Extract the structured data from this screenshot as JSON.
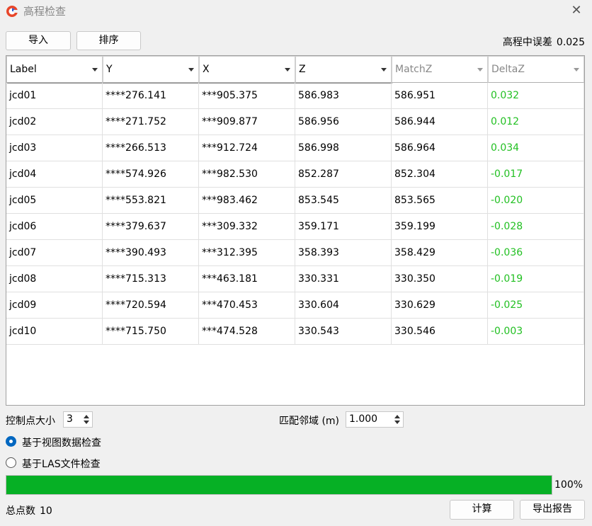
{
  "window": {
    "title": "高程检查",
    "close_icon": "close-icon"
  },
  "toolbar": {
    "import_label": "导入",
    "sort_label": "排序"
  },
  "rmse": {
    "label": "高程中误差",
    "value": "0.025"
  },
  "table": {
    "columns": [
      "Label",
      "Y",
      "X",
      "Z",
      "MatchZ",
      "DeltaZ"
    ],
    "rows": [
      [
        "jcd01",
        "****276.141",
        "***905.375",
        "586.983",
        "586.951",
        "0.032"
      ],
      [
        "jcd02",
        "****271.752",
        "***909.877",
        "586.956",
        "586.944",
        "0.012"
      ],
      [
        "jcd03",
        "****266.513",
        "***912.724",
        "586.998",
        "586.964",
        "0.034"
      ],
      [
        "jcd04",
        "****574.926",
        "***982.530",
        "852.287",
        "852.304",
        "-0.017"
      ],
      [
        "jcd05",
        "****553.821",
        "***983.462",
        "853.545",
        "853.565",
        "-0.020"
      ],
      [
        "jcd06",
        "****379.637",
        "***309.332",
        "359.171",
        "359.199",
        "-0.028"
      ],
      [
        "jcd07",
        "****390.493",
        "***312.395",
        "358.393",
        "358.429",
        "-0.036"
      ],
      [
        "jcd08",
        "****715.313",
        "***463.181",
        "330.331",
        "330.350",
        "-0.019"
      ],
      [
        "jcd09",
        "****720.594",
        "***470.453",
        "330.604",
        "330.629",
        "-0.025"
      ],
      [
        "jcd10",
        "****715.750",
        "***474.528",
        "330.543",
        "330.546",
        "-0.003"
      ]
    ]
  },
  "controls": {
    "point_size_label": "控制点大小",
    "point_size_value": "3",
    "match_radius_label": "匹配邻域 (m)",
    "match_radius_value": "1.000"
  },
  "options": {
    "view_data_label": "基于视图数据检查",
    "las_file_label": "基于LAS文件检查",
    "selected": "view_data"
  },
  "progress": {
    "value": 1.0,
    "text": "100%"
  },
  "footer": {
    "total_label": "总点数",
    "total_value": "10",
    "calc_label": "计算",
    "export_label": "导出报告"
  },
  "colors": {
    "delta": "#22c022",
    "progress": "#06b025",
    "radio_selected": "#0067c0"
  }
}
